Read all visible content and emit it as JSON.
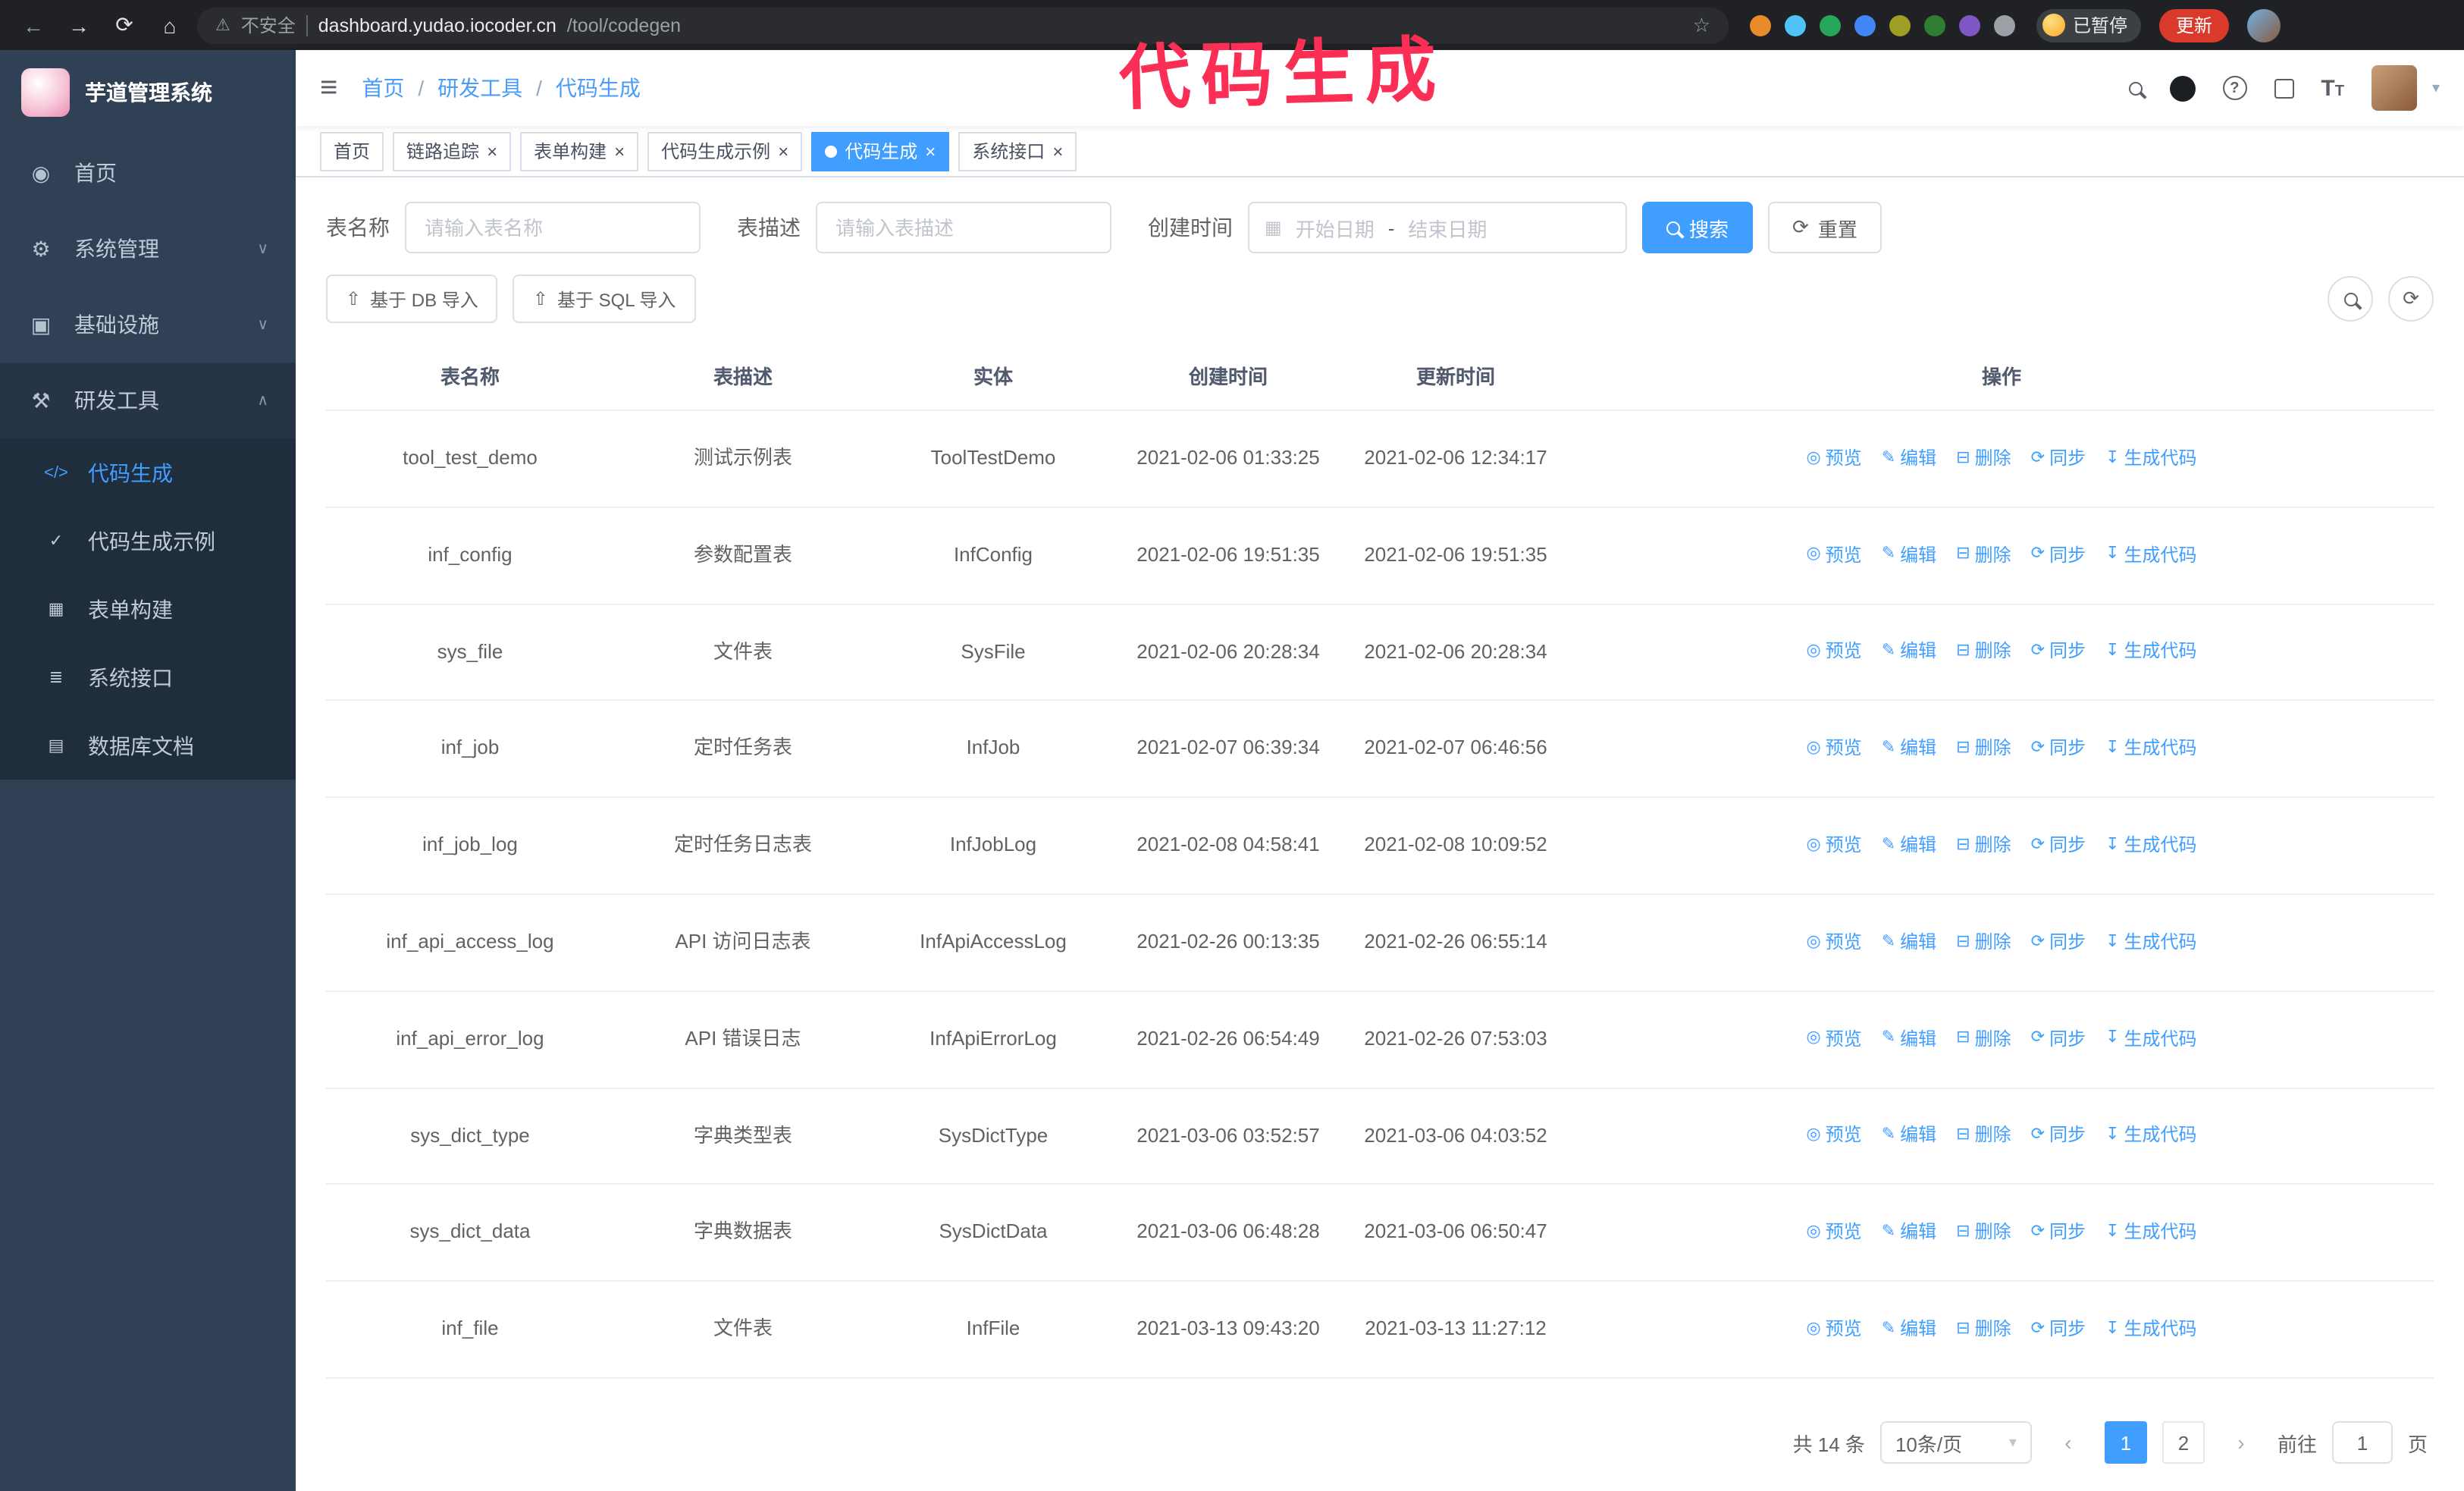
{
  "colors": {
    "accent": "#409eff",
    "sidebar_bg": "#304156",
    "submenu_bg": "#1f2d3d",
    "annotation": "#fb2e55"
  },
  "annotation": {
    "text": "代码生成"
  },
  "browser": {
    "back_glyph": "←",
    "forward_glyph": "→",
    "reload_glyph": "⟳",
    "home_glyph": "⌂",
    "warning_glyph": "⚠",
    "security_label": "不安全",
    "url_host": "dashboard.yudao.iocoder.cn",
    "url_path": "/tool/codegen",
    "star_glyph": "☆",
    "paused_badge": "已暂停",
    "update_button": "更新"
  },
  "sidebar": {
    "logo_title": "芋道管理系统",
    "items": [
      {
        "label": "首页",
        "icon": "dashboard-icon",
        "glyph": "◉",
        "chevron": ""
      },
      {
        "label": "系统管理",
        "icon": "gear-icon",
        "glyph": "⚙",
        "chevron": "∨"
      },
      {
        "label": "基础设施",
        "icon": "infrastructure-icon",
        "glyph": "▣",
        "chevron": "∨"
      },
      {
        "label": "研发工具",
        "icon": "tools-icon",
        "glyph": "⚒",
        "chevron": "∧"
      }
    ],
    "subitems": [
      {
        "label": "代码生成",
        "icon": "code-icon",
        "glyph": "</>"
      },
      {
        "label": "代码生成示例",
        "icon": "shield-check-icon",
        "glyph": "✓"
      },
      {
        "label": "表单构建",
        "icon": "form-builder-icon",
        "glyph": "▦"
      },
      {
        "label": "系统接口",
        "icon": "api-icon",
        "glyph": "≣"
      },
      {
        "label": "数据库文档",
        "icon": "database-doc-icon",
        "glyph": "▤"
      }
    ]
  },
  "header": {
    "hamburger_glyph": "≡",
    "breadcrumb": [
      {
        "label": "首页"
      },
      {
        "label": "研发工具"
      },
      {
        "label": "代码生成"
      }
    ],
    "separator": "/",
    "question_glyph": "?",
    "font_size_glyph": "T",
    "font_size_glyph_small": "T",
    "caret_glyph": "▾"
  },
  "tabs": [
    {
      "label": "首页"
    },
    {
      "label": "链路追踪",
      "close": "×"
    },
    {
      "label": "表单构建",
      "close": "×"
    },
    {
      "label": "代码生成示例",
      "close": "×"
    },
    {
      "label": "代码生成",
      "close": "×"
    },
    {
      "label": "系统接口",
      "close": "×"
    }
  ],
  "filters": {
    "table_name_label": "表名称",
    "table_name_placeholder": "请输入表名称",
    "table_desc_label": "表描述",
    "table_desc_placeholder": "请输入表描述",
    "create_time_label": "创建时间",
    "calendar_glyph": "▦",
    "start_date_placeholder": "开始日期",
    "range_separator": "-",
    "end_date_placeholder": "结束日期",
    "search_button": "搜索",
    "reset_button": "重置",
    "reset_glyph": "⟳"
  },
  "toolbar": {
    "import_db_button": "基于 DB 导入",
    "import_sql_button": "基于 SQL 导入",
    "upload_glyph": "⇧",
    "refresh_glyph": "⟳"
  },
  "table": {
    "columns": [
      "表名称",
      "表描述",
      "实体",
      "创建时间",
      "更新时间",
      "操作"
    ],
    "actions": [
      {
        "id": "preview",
        "label": "预览",
        "icon": "eye-icon",
        "glyph": "◎"
      },
      {
        "id": "edit",
        "label": "编辑",
        "icon": "edit-icon",
        "glyph": "✎"
      },
      {
        "id": "delete",
        "label": "删除",
        "icon": "trash-icon",
        "glyph": "⊟"
      },
      {
        "id": "sync",
        "label": "同步",
        "icon": "sync-icon",
        "glyph": "⟳"
      },
      {
        "id": "generate",
        "label": "生成代码",
        "icon": "download-icon",
        "glyph": "↧"
      }
    ],
    "rows": [
      {
        "name": "tool_test_demo",
        "desc": "测试示例表",
        "entity": "ToolTestDemo",
        "created": "2021-02-06 01:33:25",
        "updated": "2021-02-06 12:34:17"
      },
      {
        "name": "inf_config",
        "desc": "参数配置表",
        "entity": "InfConfig",
        "created": "2021-02-06 19:51:35",
        "updated": "2021-02-06 19:51:35"
      },
      {
        "name": "sys_file",
        "desc": "文件表",
        "entity": "SysFile",
        "created": "2021-02-06 20:28:34",
        "updated": "2021-02-06 20:28:34"
      },
      {
        "name": "inf_job",
        "desc": "定时任务表",
        "entity": "InfJob",
        "created": "2021-02-07 06:39:34",
        "updated": "2021-02-07 06:46:56"
      },
      {
        "name": "inf_job_log",
        "desc": "定时任务日志表",
        "entity": "InfJobLog",
        "created": "2021-02-08 04:58:41",
        "updated": "2021-02-08 10:09:52"
      },
      {
        "name": "inf_api_access_log",
        "desc": "API 访问日志表",
        "entity": "InfApiAccessLog",
        "created": "2021-02-26 00:13:35",
        "updated": "2021-02-26 06:55:14"
      },
      {
        "name": "inf_api_error_log",
        "desc": "API 错误日志",
        "entity": "InfApiErrorLog",
        "created": "2021-02-26 06:54:49",
        "updated": "2021-02-26 07:53:03"
      },
      {
        "name": "sys_dict_type",
        "desc": "字典类型表",
        "entity": "SysDictType",
        "created": "2021-03-06 03:52:57",
        "updated": "2021-03-06 04:03:52"
      },
      {
        "name": "sys_dict_data",
        "desc": "字典数据表",
        "entity": "SysDictData",
        "created": "2021-03-06 06:48:28",
        "updated": "2021-03-06 06:50:47"
      },
      {
        "name": "inf_file",
        "desc": "文件表",
        "entity": "InfFile",
        "created": "2021-03-13 09:43:20",
        "updated": "2021-03-13 11:27:12"
      }
    ]
  },
  "pagination": {
    "total": "共 14 条",
    "page_size": "10条/页",
    "caret_glyph": "▾",
    "prev_glyph": "‹",
    "next_glyph": "›",
    "pages": [
      "1",
      "2"
    ],
    "goto_label": "前往",
    "goto_value": "1",
    "unit_label": "页"
  }
}
